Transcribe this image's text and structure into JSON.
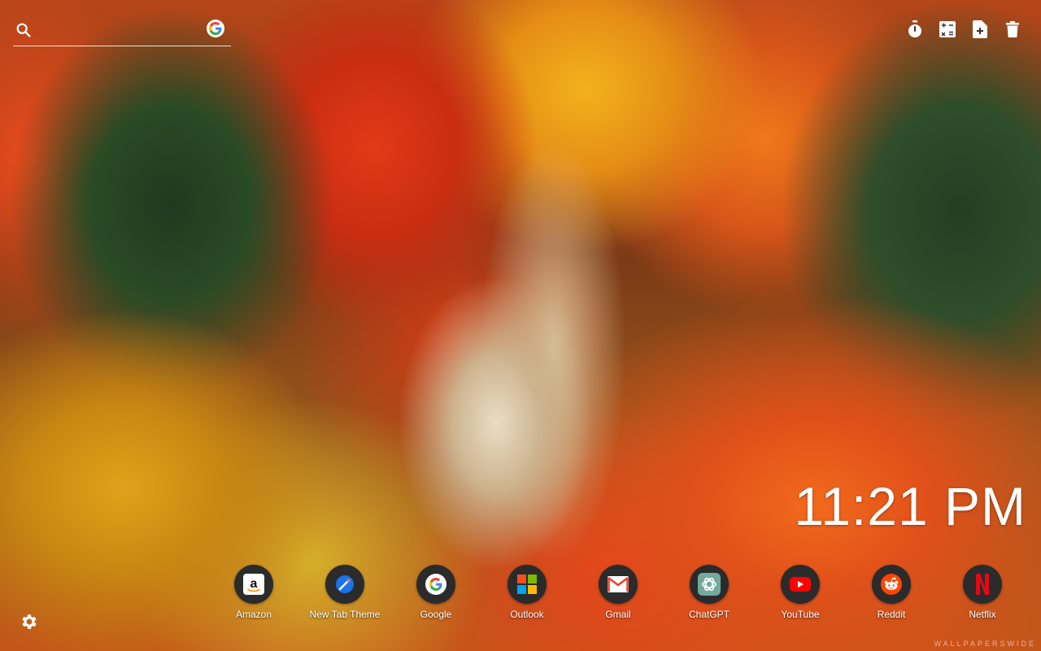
{
  "search": {
    "placeholder": "",
    "engine_icon": "google-g-icon"
  },
  "toolbar": {
    "items": [
      {
        "icon": "stopwatch-icon"
      },
      {
        "icon": "calculator-icon"
      },
      {
        "icon": "new-document-icon"
      },
      {
        "icon": "trash-icon"
      }
    ]
  },
  "clock": {
    "time": "11:21 PM"
  },
  "shortcuts": [
    {
      "label": "Amazon",
      "icon": "amazon-icon"
    },
    {
      "label": "New Tab Theme",
      "icon": "new-tab-theme-icon"
    },
    {
      "label": "Google",
      "icon": "google-icon"
    },
    {
      "label": "Outlook",
      "icon": "outlook-icon"
    },
    {
      "label": "Gmail",
      "icon": "gmail-icon"
    },
    {
      "label": "ChatGPT",
      "icon": "chatgpt-icon"
    },
    {
      "label": "YouTube",
      "icon": "youtube-icon"
    },
    {
      "label": "Reddit",
      "icon": "reddit-icon"
    },
    {
      "label": "Netflix",
      "icon": "netflix-icon"
    }
  ],
  "settings": {
    "icon": "gear-icon"
  },
  "watermark": "WALLPAPERSWIDE",
  "colors": {
    "text": "#ffffff",
    "shortcut_circle": "#2b2b2b",
    "youtube_red": "#ff0000",
    "netflix_red": "#e50914",
    "reddit_orange": "#ff4500"
  }
}
